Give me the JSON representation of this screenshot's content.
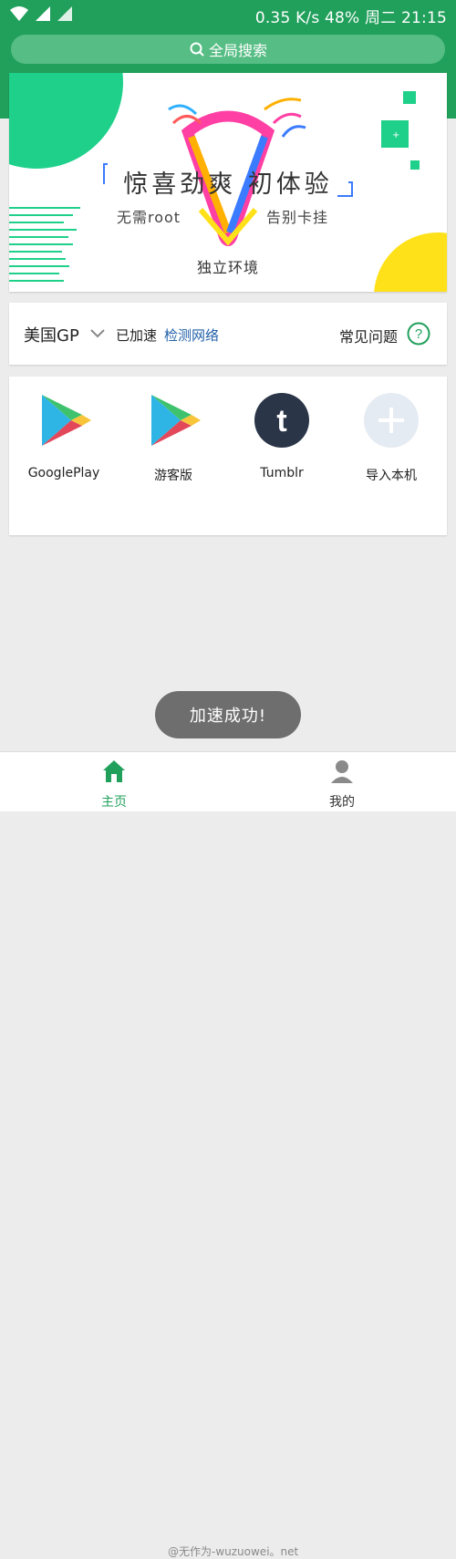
{
  "status_bar": {
    "right_text": "0.35 K/s 48%  周二 21:15"
  },
  "search": {
    "label": "全局搜索"
  },
  "banner": {
    "title": "惊喜劲爽  初体验",
    "left_sub": "无需root",
    "right_sub": "告别卡挂",
    "bottom": "独立环境"
  },
  "region": {
    "name": "美国GP",
    "status": "已加速",
    "check_network": "检测网络",
    "faq": "常见问题"
  },
  "apps": [
    {
      "label": "GooglePlay",
      "icon": "google-play-icon"
    },
    {
      "label": "游客版",
      "icon": "google-play-icon"
    },
    {
      "label": "Tumblr",
      "icon": "tumblr-icon"
    },
    {
      "label": "导入本机",
      "icon": "add-icon"
    }
  ],
  "toast": {
    "text": "加速成功!"
  },
  "bottom_nav": {
    "home": "主页",
    "mine": "我的"
  },
  "watermark": "@无作为-wuzuowei。net",
  "colors": {
    "brand_green": "#21a05c",
    "link_blue": "#1f5fa8",
    "toast_bg": "#6e6e6e"
  }
}
